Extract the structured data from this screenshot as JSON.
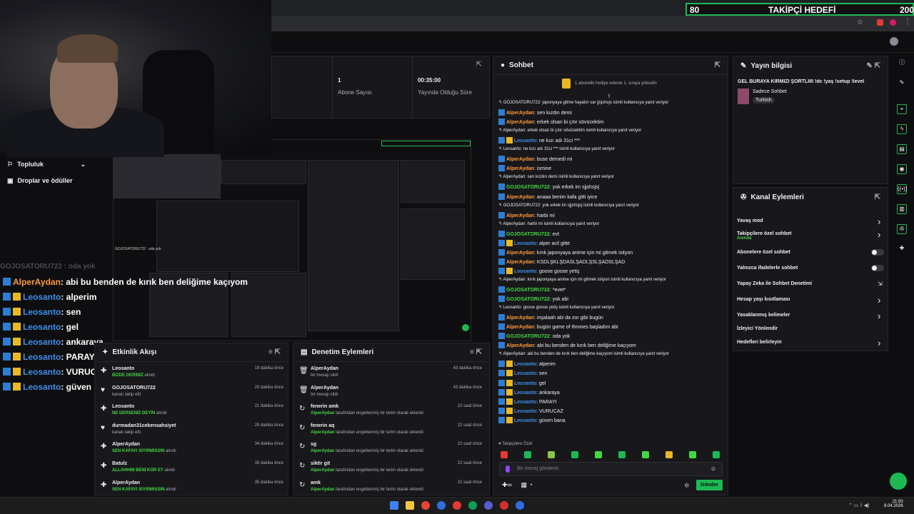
{
  "goal": {
    "left_value": "80",
    "title": "TAKİPÇİ HEDEFİ",
    "right_value": "200"
  },
  "stats": [
    {
      "value": "1",
      "label": "Abone Sayısı"
    },
    {
      "value": "00:35:00",
      "label": "Yayında Olduğu Süre"
    }
  ],
  "sidebar": {
    "items": [
      {
        "label": "Topluluk"
      },
      {
        "label": "Droplar ve ödüller"
      }
    ]
  },
  "overlay": {
    "faded": "GOJOSATORU722 : oda yok",
    "lines": [
      {
        "user": "AlperAydan",
        "text": ": abi bu benden de kırık ben deliğime kaçıyom",
        "color": "#ff9a3c"
      },
      {
        "user": "Leosanto",
        "text": ": alperim",
        "color": "#3e8ee8"
      },
      {
        "user": "Leosanto",
        "text": ": sen",
        "color": "#3e8ee8"
      },
      {
        "user": "Leosanto",
        "text": ": gel",
        "color": "#3e8ee8"
      },
      {
        "user": "Leosanto",
        "text": ": ankaraya",
        "color": "#3e8ee8"
      },
      {
        "user": "Leosanto",
        "text": ": PARAYI",
        "color": "#3e8ee8"
      },
      {
        "user": "Leosanto",
        "text": ": VURUCAZ",
        "color": "#3e8ee8"
      },
      {
        "user": "Leosanto",
        "text": ": güven bana",
        "color": "#3e8ee8"
      }
    ]
  },
  "chat": {
    "title": "Sohbet",
    "pinned": "1 abonelik hediye ederek 1. sıraya yükselin",
    "messages": [
      {
        "reply": "GOJOSATORU722: japonyaya gitme hayatın var jjsjshsjs isimli kullanıcıya yanıt veriyor"
      },
      {
        "user": "AlperAydan",
        "color": "#ff9a3c",
        "text": ": sen kızdın demi"
      },
      {
        "user": "AlperAydan",
        "color": "#ff9a3c",
        "text": ": erkek olsan bi çıtır sövücektim"
      },
      {
        "reply": "AlperAydan: erkek olsan bi çıtır sövücektim isimli kullanıcıya yanıt veriyor"
      },
      {
        "user": "Leosanto",
        "color": "#3e8ee8",
        "text": ": ne kızı adı 31ci ***"
      },
      {
        "reply": "Leosanto: ne kızı adı 31ci *** isimli kullanıcıya yanıt veriyor"
      },
      {
        "user": "AlperAydan",
        "color": "#ff9a3c",
        "text": ": buse demedi mi"
      },
      {
        "user": "AlperAydan",
        "color": "#ff9a3c",
        "text": ": ismine"
      },
      {
        "reply": "AlperAydan: sen kızdın demi isimli kullanıcıya yanıt veriyor"
      },
      {
        "user": "GOJOSATORU722",
        "color": "#43d843",
        "text": ": yok erkek im sjjshsjsj"
      },
      {
        "user": "AlperAydan",
        "color": "#ff9a3c",
        "text": ": anaaa benim kafa gitti iyice"
      },
      {
        "reply": "GOJOSATORU722: yok erkek im sjjshsjsj isimli kullanıcıya yanıt veriyor"
      },
      {
        "user": "AlperAydan",
        "color": "#ff9a3c",
        "text": ": harbi mi"
      },
      {
        "reply": "AlperAydan: harbi mi isimli kullanıcıya yanıt veriyor"
      },
      {
        "user": "GOJOSATORU722",
        "color": "#43d843",
        "text": ": evt"
      },
      {
        "user": "Leosanto",
        "color": "#3e8ee8",
        "text": ": alper acil gitte"
      },
      {
        "user": "AlperAydan",
        "color": "#ff9a3c",
        "text": ": kırık japonyaya anime için mi gitmek isityon"
      },
      {
        "user": "AlperAydan",
        "color": "#ff9a3c",
        "text": ": KSDLŞKLŞDASLŞADLŞSLŞADSLŞAD"
      },
      {
        "user": "Leosanto",
        "color": "#3e8ee8",
        "text": ": goose goose yetiş"
      },
      {
        "reply": "AlperAydan: kırık japonyaya anime için mi gitmek isityon isimli kullanıcıya yanıt veriyor"
      },
      {
        "user": "GOJOSATORU722",
        "color": "#43d843",
        "text": ": *evet*"
      },
      {
        "user": "GOJOSATORU722",
        "color": "#43d843",
        "text": ": yok abi"
      },
      {
        "reply": "Leosanto: goose goose yetiş isimli kullanıcıya yanıt veriyor"
      },
      {
        "user": "AlperAydan",
        "color": "#ff9a3c",
        "text": ": inşalaah abi da zor gibi bugün"
      },
      {
        "user": "AlperAydan",
        "color": "#ff9a3c",
        "text": ": bugün game of thrones başladım abi"
      },
      {
        "user": "GOJOSATORU722",
        "color": "#43d843",
        "text": ": oda yok"
      },
      {
        "user": "AlperAydan",
        "color": "#ff9a3c",
        "text": ": abi bu benden de kırık ben deliğime kaçıyom"
      },
      {
        "reply": "AlperAydan: abi bu benden de kırık ben deliğime kaçıyom isimli kullanıcıya yanıt veriyor"
      },
      {
        "user": "Leosanto",
        "color": "#3e8ee8",
        "text": ": alperim"
      },
      {
        "user": "Leosanto",
        "color": "#3e8ee8",
        "text": ": sen"
      },
      {
        "user": "Leosanto",
        "color": "#3e8ee8",
        "text": ": gel"
      },
      {
        "user": "Leosanto",
        "color": "#3e8ee8",
        "text": ": ankaraya"
      },
      {
        "user": "Leosanto",
        "color": "#3e8ee8",
        "text": ": PARAYI"
      },
      {
        "user": "Leosanto",
        "color": "#3e8ee8",
        "text": ": VURUCAZ"
      },
      {
        "user": "Leosanto",
        "color": "#3e8ee8",
        "text": ": güven bana"
      }
    ],
    "followers_only": "Takipçilere Özel",
    "placeholder": "Bir mesaj gönderin",
    "send": "Gönder"
  },
  "stream_info": {
    "title": "Yayın bilgisi",
    "stream_title": "GEL BURAYA KIRMIZI ŞORTLIIII !dc !yaş !setup !level",
    "category": "Sadece Sohbet",
    "tag": "Turkish"
  },
  "channel_actions": {
    "title": "Kanal Eylemleri",
    "items": [
      {
        "label": "Yavaş mod",
        "sub": "",
        "control": "chevron"
      },
      {
        "label": "Takipçilere özel sohbet",
        "sub": "Anında",
        "control": "chevron"
      },
      {
        "label": "Abonelere özel sohbet",
        "sub": "",
        "control": "toggle"
      },
      {
        "label": "Yalnızca ifadelerle sohbet",
        "sub": "",
        "control": "toggle"
      },
      {
        "label": "Yapay Zeka ile Sohbet Denetimi",
        "sub": "",
        "control": "external"
      },
      {
        "label": "Hesap yaşı kısıtlaması",
        "sub": "",
        "control": "chevron"
      },
      {
        "label": "Yasaklanmış kelimeler",
        "sub": "",
        "control": "chevron"
      },
      {
        "label": "İzleyici Yönlendir",
        "sub": "",
        "control": "none"
      },
      {
        "label": "Hedefleri belirleyin",
        "sub": "",
        "control": "chevron"
      }
    ]
  },
  "activity": {
    "title": "Etkinlik Akışı",
    "rows": [
      {
        "icon": "✚",
        "user": "Leosanto",
        "detail_b": "BİZDE DERİNİZ",
        "detail": " alındı",
        "time": "19 dakika önce"
      },
      {
        "icon": "♥",
        "user": "GOJOSATORU722",
        "detail_b": "",
        "detail": "kanalı takip etti",
        "time": "20 dakika önce"
      },
      {
        "icon": "✚",
        "user": "Leosanto",
        "detail_b": "NE DERSENİZ DEYİN",
        "detail": " alındı",
        "time": "21 dakika önce"
      },
      {
        "icon": "♥",
        "user": "durmadan31cekensahsiyet",
        "detail_b": "",
        "detail": "kanalı takip etti",
        "time": "25 dakika önce"
      },
      {
        "icon": "✚",
        "user": "AlperAydan",
        "detail_b": "SEN KAFAYI SIYIRMISSIN",
        "detail": " alındı",
        "time": "34 dakika önce"
      },
      {
        "icon": "✚",
        "user": "Batulz",
        "detail_b": "ALLAHHIM BENİ KÖR ET",
        "detail": " alındı",
        "time": "35 dakika önce"
      },
      {
        "icon": "✚",
        "user": "AlperAydan",
        "detail_b": "SEN KAFAYI SIYIRMISSIN",
        "detail": " alındı",
        "time": "35 dakika önce"
      }
    ]
  },
  "moderation": {
    "title": "Denetim Eylemleri",
    "rows": [
      {
        "icon": "🗑",
        "user": "AlperAydan",
        "detail_b": "",
        "detail": "bir mesajı sildi",
        "time": "43 dakika önce"
      },
      {
        "icon": "🗑",
        "user": "AlperAydan",
        "detail_b": "",
        "detail": "bir mesajı sildi",
        "time": "43 dakika önce"
      },
      {
        "icon": "↻",
        "user": "fenerin amk",
        "detail_b": "AlperAydan",
        "detail": " tarafından engellenmiş bir terim olarak eklendi",
        "time": "22 saat önce"
      },
      {
        "icon": "↻",
        "user": "fenerin aq",
        "detail_b": "AlperAydan",
        "detail": " tarafından engellenmiş bir terim olarak eklendi",
        "time": "22 saat önce"
      },
      {
        "icon": "↻",
        "user": "sg",
        "detail_b": "AlperAydan",
        "detail": " tarafından engellenmiş bir terim olarak eklendi",
        "time": "22 saat önce"
      },
      {
        "icon": "↻",
        "user": "siktir git",
        "detail_b": "AlperAydan",
        "detail": " tarafından engellenmiş bir terim olarak eklendi",
        "time": "22 saat önce"
      },
      {
        "icon": "↻",
        "user": "amk",
        "detail_b": "AlperAydan",
        "detail": " tarafından engellenmiş bir terim olarak eklendi",
        "time": "22 saat önce"
      }
    ]
  },
  "clock": {
    "time": "21:50",
    "date": "8.04.2026"
  },
  "colors": {
    "accent": "#1db954",
    "panel": "#18181b",
    "bg": "#0e0e10"
  }
}
